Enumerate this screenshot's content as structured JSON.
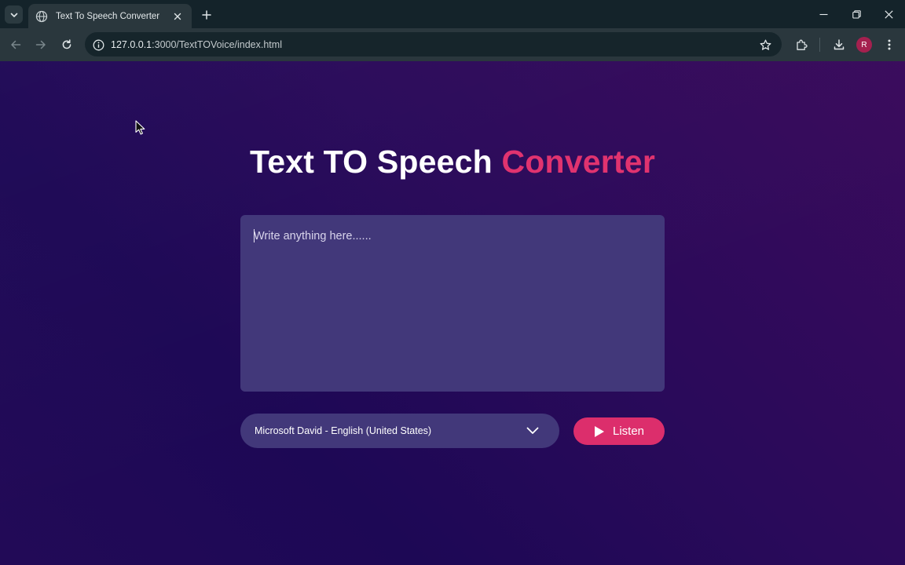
{
  "browser": {
    "tab_title": "Text To Speech Converter",
    "url_host": "127.0.0.1",
    "url_rest": ":3000/TextTOVoice/index.html",
    "profile_initial": "R"
  },
  "page": {
    "title_main": "Text TO Speech ",
    "title_accent": "Converter",
    "textarea_placeholder": "Write anything here......",
    "voice_selected": "Microsoft David - English (United States)",
    "listen_label": "Listen"
  },
  "colors": {
    "accent": "#e0336f",
    "button": "#dc2e6c",
    "panel": "#42387a"
  },
  "icons": [
    "chevron-down-icon",
    "globe-icon",
    "close-icon",
    "plus-icon",
    "minimize-icon",
    "restore-icon",
    "back-arrow-icon",
    "forward-arrow-icon",
    "reload-icon",
    "info-icon",
    "star-icon",
    "extensions-icon",
    "download-icon",
    "more-vert-icon",
    "play-icon",
    "mouse-pointer-icon"
  ]
}
